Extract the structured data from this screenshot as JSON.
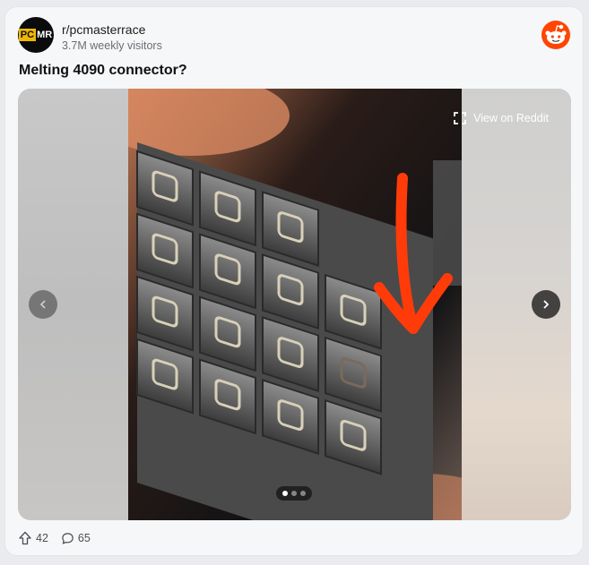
{
  "subreddit": {
    "name": "r/pcmasterrace",
    "visitors": "3.7M weekly visitors",
    "avatar_text_a": "PC",
    "avatar_text_b": "MR"
  },
  "post": {
    "title": "Melting 4090 connector?"
  },
  "media": {
    "view_on_reddit": "View on Reddit",
    "carousel": {
      "current": 1,
      "total": 3
    }
  },
  "actions": {
    "upvotes": "42",
    "comments": "65"
  },
  "colors": {
    "reddit_orange": "#ff4500",
    "arrow_red": "#ff3b0a"
  }
}
